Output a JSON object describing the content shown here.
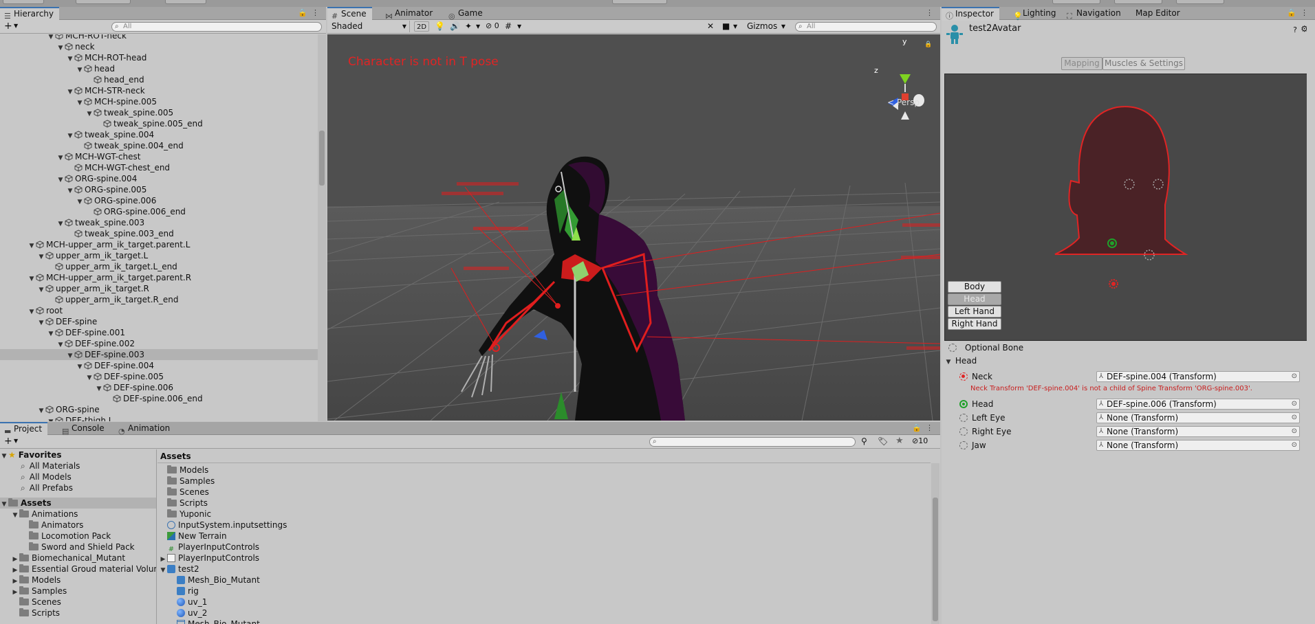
{
  "hierarchy": {
    "tab": "Hierarchy",
    "search_placeholder": "All",
    "rows": [
      {
        "label": "MCH-ROT-neck",
        "depth": 5,
        "expand": "open"
      },
      {
        "label": "neck",
        "depth": 6,
        "expand": "open"
      },
      {
        "label": "MCH-ROT-head",
        "depth": 7,
        "expand": "open"
      },
      {
        "label": "head",
        "depth": 8,
        "expand": "open"
      },
      {
        "label": "head_end",
        "depth": 9,
        "expand": "none"
      },
      {
        "label": "MCH-STR-neck",
        "depth": 7,
        "expand": "open"
      },
      {
        "label": "MCH-spine.005",
        "depth": 8,
        "expand": "open"
      },
      {
        "label": "tweak_spine.005",
        "depth": 9,
        "expand": "open"
      },
      {
        "label": "tweak_spine.005_end",
        "depth": 10,
        "expand": "none"
      },
      {
        "label": "tweak_spine.004",
        "depth": 7,
        "expand": "open"
      },
      {
        "label": "tweak_spine.004_end",
        "depth": 8,
        "expand": "none"
      },
      {
        "label": "MCH-WGT-chest",
        "depth": 6,
        "expand": "open"
      },
      {
        "label": "MCH-WGT-chest_end",
        "depth": 7,
        "expand": "none"
      },
      {
        "label": "ORG-spine.004",
        "depth": 6,
        "expand": "open"
      },
      {
        "label": "ORG-spine.005",
        "depth": 7,
        "expand": "open"
      },
      {
        "label": "ORG-spine.006",
        "depth": 8,
        "expand": "open"
      },
      {
        "label": "ORG-spine.006_end",
        "depth": 9,
        "expand": "none"
      },
      {
        "label": "tweak_spine.003",
        "depth": 6,
        "expand": "open"
      },
      {
        "label": "tweak_spine.003_end",
        "depth": 7,
        "expand": "none"
      },
      {
        "label": "MCH-upper_arm_ik_target.parent.L",
        "depth": 3,
        "expand": "open"
      },
      {
        "label": "upper_arm_ik_target.L",
        "depth": 4,
        "expand": "open"
      },
      {
        "label": "upper_arm_ik_target.L_end",
        "depth": 5,
        "expand": "none"
      },
      {
        "label": "MCH-upper_arm_ik_target.parent.R",
        "depth": 3,
        "expand": "open"
      },
      {
        "label": "upper_arm_ik_target.R",
        "depth": 4,
        "expand": "open"
      },
      {
        "label": "upper_arm_ik_target.R_end",
        "depth": 5,
        "expand": "none"
      },
      {
        "label": "root",
        "depth": 3,
        "expand": "open"
      },
      {
        "label": "DEF-spine",
        "depth": 4,
        "expand": "open"
      },
      {
        "label": "DEF-spine.001",
        "depth": 5,
        "expand": "open"
      },
      {
        "label": "DEF-spine.002",
        "depth": 6,
        "expand": "open"
      },
      {
        "label": "DEF-spine.003",
        "depth": 7,
        "expand": "open",
        "selected": true
      },
      {
        "label": "DEF-spine.004",
        "depth": 8,
        "expand": "open"
      },
      {
        "label": "DEF-spine.005",
        "depth": 9,
        "expand": "open"
      },
      {
        "label": "DEF-spine.006",
        "depth": 10,
        "expand": "open"
      },
      {
        "label": "DEF-spine.006_end",
        "depth": 11,
        "expand": "none"
      },
      {
        "label": "ORG-spine",
        "depth": 4,
        "expand": "open"
      },
      {
        "label": "DEF-thigh.L",
        "depth": 5,
        "expand": "open"
      }
    ]
  },
  "scene": {
    "tabs": [
      "Scene",
      "Animator",
      "Game"
    ],
    "shading": "Shaded",
    "mode_2d": "2D",
    "hidden_count": "0",
    "gizmos": "Gizmos",
    "search_placeholder": "All",
    "message": "Character is not in T pose",
    "persp": "< Persp",
    "axis_y": "y",
    "axis_z": "z"
  },
  "inspector": {
    "tabs": [
      "Inspector",
      "Lighting",
      "Navigation",
      "Map Editor"
    ],
    "title": "test2Avatar",
    "mapping_tab": "Mapping",
    "muscles_tab": "Muscles & Settings",
    "body_buttons": [
      "Body",
      "Head",
      "Left Hand",
      "Right Hand"
    ],
    "optional_bone": "Optional Bone",
    "section": "Head",
    "bones": [
      {
        "label": "Neck",
        "value": "DEF-spine.004 (Transform)",
        "status": "error"
      },
      {
        "label": "Head",
        "value": "DEF-spine.006 (Transform)",
        "status": "ok"
      },
      {
        "label": "Left Eye",
        "value": "None (Transform)",
        "status": "optional"
      },
      {
        "label": "Right Eye",
        "value": "None (Transform)",
        "status": "optional"
      },
      {
        "label": "Jaw",
        "value": "None (Transform)",
        "status": "optional"
      }
    ],
    "error_message": "Neck Transform 'DEF-spine.004' is not a child of Spine Transform 'ORG-spine.003'."
  },
  "project": {
    "tabs": [
      "Project",
      "Console",
      "Animation"
    ],
    "hidden_count": "10",
    "favorites_label": "Favorites",
    "favorites": [
      "All Materials",
      "All Models",
      "All Prefabs"
    ],
    "assets_label": "Assets",
    "tree": [
      {
        "label": "Animations",
        "depth": 1,
        "expand": "open"
      },
      {
        "label": "Animators",
        "depth": 2,
        "expand": "none"
      },
      {
        "label": "Locomotion Pack",
        "depth": 2,
        "expand": "none"
      },
      {
        "label": "Sword and Shield Pack",
        "depth": 2,
        "expand": "none"
      },
      {
        "label": "Biomechanical_Mutant",
        "depth": 1,
        "expand": "closed"
      },
      {
        "label": "Essential Groud material Volume",
        "depth": 1,
        "expand": "closed"
      },
      {
        "label": "Models",
        "depth": 1,
        "expand": "closed"
      },
      {
        "label": "Samples",
        "depth": 1,
        "expand": "closed"
      },
      {
        "label": "Scenes",
        "depth": 1,
        "expand": "none"
      },
      {
        "label": "Scripts",
        "depth": 1,
        "expand": "none"
      }
    ],
    "breadcrumb": "Assets",
    "items": [
      {
        "label": "Models",
        "kind": "folder",
        "depth": 0
      },
      {
        "label": "Samples",
        "kind": "folder",
        "depth": 0
      },
      {
        "label": "Scenes",
        "kind": "folder",
        "depth": 0
      },
      {
        "label": "Scripts",
        "kind": "folder",
        "depth": 0
      },
      {
        "label": "Yuponic",
        "kind": "folder",
        "depth": 0
      },
      {
        "label": "InputSystem.inputsettings",
        "kind": "settings",
        "depth": 0
      },
      {
        "label": "New Terrain",
        "kind": "terrain",
        "depth": 0
      },
      {
        "label": "PlayerInputControls",
        "kind": "script",
        "depth": 0
      },
      {
        "label": "PlayerInputControls",
        "kind": "asset",
        "depth": 0,
        "expand": "closed"
      },
      {
        "label": "test2",
        "kind": "model",
        "depth": 0,
        "expand": "open"
      },
      {
        "label": "Mesh_Bio_Mutant",
        "kind": "model",
        "depth": 1
      },
      {
        "label": "rig",
        "kind": "model",
        "depth": 1
      },
      {
        "label": "uv_1",
        "kind": "sphere",
        "depth": 1
      },
      {
        "label": "uv_2",
        "kind": "sphere",
        "depth": 1
      },
      {
        "label": "Mesh_Bio_Mutant",
        "kind": "mesh",
        "depth": 1
      }
    ]
  },
  "colors": {
    "accent": "#3a72b0",
    "error": "#e02424",
    "ok": "#1fa12a",
    "silhouette": "#4a2226"
  }
}
